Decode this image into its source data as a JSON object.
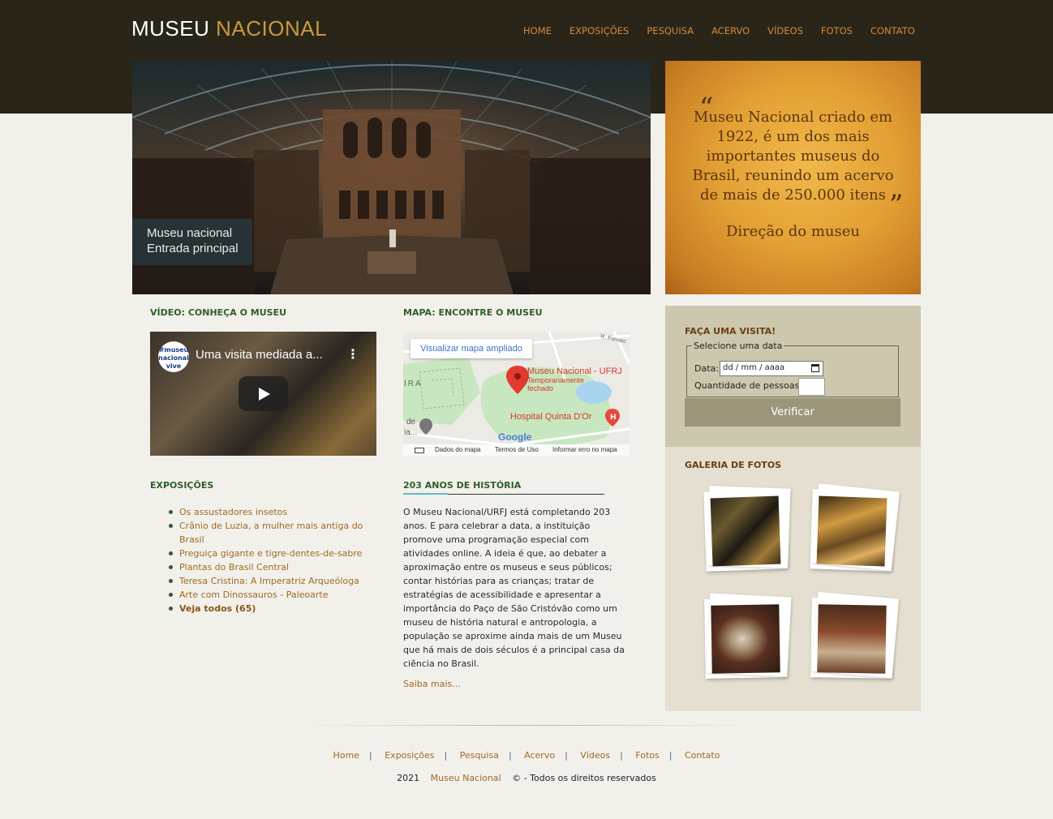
{
  "header": {
    "logo_word1": "MUSEU",
    "logo_word2": "NACIONAL",
    "nav": [
      "HOME",
      "EXPOSIÇÕES",
      "PESQUISA",
      "ACERVO",
      "VÍDEOS",
      "FOTOS",
      "CONTATO"
    ]
  },
  "hero": {
    "caption_line1": "Museu nacional",
    "caption_line2": "Entrada principal"
  },
  "quote": {
    "open": "“",
    "text": "Museu Nacional criado em 1922, é um dos mais importantes museus do Brasil, reunindo um acervo de mais de 250.000 itens",
    "close": "”",
    "author": "Direção do museu"
  },
  "video": {
    "section_title": "VÍDEO: CONHEÇA O MUSEU",
    "channel_logo": "#museu nacional vive",
    "title": "Uma visita mediada a...",
    "menu_icon": "⋮"
  },
  "map": {
    "section_title": "MAPA: ENCONTRE O MUSEU",
    "button": "Visualizar mapa ampliado",
    "pin_label": "Museu Nacional - UFRJ",
    "pin_status": "Temporariamente fechado",
    "hospital": "Hospital Quinta D'Or",
    "street": "R. Fonsec",
    "side_text": "IRA",
    "side_text2": "de",
    "side_text3": "ia...",
    "google": "Google",
    "footer": [
      "Dados do mapa",
      "Termos de Uso",
      "Informar erro no mapa"
    ]
  },
  "exposicoes": {
    "section_title": "EXPOSIÇÕES",
    "items": [
      "Os assustadores insetos",
      "Crânio de Luzia, a mulher mais antiga do Brasil",
      "Preguiça gigante e tigre-dentes-de-sabre",
      "Plantas do Brasil Central",
      "Teresa Cristina: A Imperatriz Arqueóloga",
      "Arte com Dinossauros - Paleoarte"
    ],
    "see_all": "Veja todos (65)"
  },
  "historia": {
    "title": "203 ANOS DE HISTÓRIA",
    "text": "O Museu Nacional/URFJ está completando 203 anos. E para celebrar a data, a instituição promove uma programação especial com atividades online. A ideia é que, ao debater a aproximação entre os museus e seus públicos; contar histórias para as crianças; tratar de estratégias de acessibilidade e apresentar a importância do Paço de São Cristóvão como um museu de história natural e antropologia, a população se aproxime ainda mais de um Museu que há mais de dois séculos é a principal casa da ciência no Brasil.",
    "more": "Saiba mais..."
  },
  "visita": {
    "title": "FAÇA UMA VISITA!",
    "legend": "Selecione uma data",
    "date_label": "Data:",
    "date_placeholder": "dd / mm / aaaa",
    "qty_label": "Quantidade de pessoas:",
    "button": "Verificar"
  },
  "galeria": {
    "title": "GALERIA DE FOTOS"
  },
  "footer": {
    "links": [
      "Home",
      "Exposições",
      "Pesquisa",
      "Acervo",
      "Vídeos",
      "Fotos",
      "Contato"
    ],
    "year": "2021",
    "brand": "Museu Nacional",
    "rights": "© - Todos os direitos reservados"
  }
}
